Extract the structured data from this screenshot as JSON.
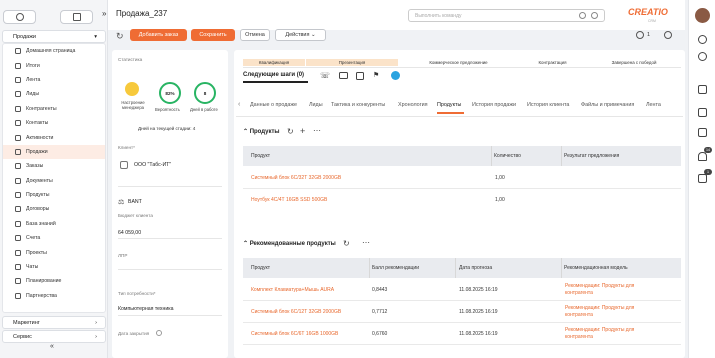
{
  "sidebar": {
    "section_label": "Продажи",
    "items": [
      {
        "label": "Домашняя страница",
        "icon": "home-icon"
      },
      {
        "label": "Итоги",
        "icon": "dashboard-icon"
      },
      {
        "label": "Лента",
        "icon": "feed-icon"
      },
      {
        "label": "Лиды",
        "icon": "lead-icon"
      },
      {
        "label": "Контрагенты",
        "icon": "company-icon"
      },
      {
        "label": "Контакты",
        "icon": "contact-icon"
      },
      {
        "label": "Активности",
        "icon": "calendar-icon"
      },
      {
        "label": "Продажи",
        "icon": "deal-icon",
        "active": true
      },
      {
        "label": "Заказы",
        "icon": "cart-icon"
      },
      {
        "label": "Документы",
        "icon": "document-icon"
      },
      {
        "label": "Продукты",
        "icon": "product-icon"
      },
      {
        "label": "Договоры",
        "icon": "contract-icon"
      },
      {
        "label": "База знаний",
        "icon": "knowledge-icon"
      },
      {
        "label": "Счета",
        "icon": "invoice-icon"
      },
      {
        "label": "Проекты",
        "icon": "project-icon"
      },
      {
        "label": "Чаты",
        "icon": "chat-icon"
      },
      {
        "label": "Планирование",
        "icon": "planning-icon"
      },
      {
        "label": "Партнерства",
        "icon": "partnership-icon"
      }
    ],
    "marketing_label": "Маркетинг",
    "service_label": "Сервис"
  },
  "header": {
    "title": "Продажа_237",
    "command_placeholder": "Выполнить команду",
    "brand": "CREATIO",
    "brand_sub": "CRM"
  },
  "toolbar": {
    "add_order_label": "Добавить заказ",
    "save_label": "Сохранить",
    "cancel_label": "Отмена",
    "actions_label": "Действия",
    "counter": "1"
  },
  "left_panel": {
    "stats_label": "Статистика",
    "mood_label": "Настроение менеджера",
    "probability_value": "82%",
    "probability_label": "Вероятность",
    "days_in_work_value": "8",
    "days_in_work_label": "Дней в работе",
    "days_in_stage_label": "Дней на текущей стадии:",
    "days_in_stage_value": "4",
    "client_label": "Клиент*",
    "client_value": "ООО \"Табс-ИТ\"",
    "bant_label": "BANT",
    "budget_label": "Бюджет клиента",
    "budget_value": "64 059,00",
    "lpr_label": "ЛПР",
    "need_type_label": "Тип потребности*",
    "need_type_value": "Компьютерная техника",
    "close_date_label": "Дата закрытия"
  },
  "stages": [
    "Квалификация",
    "Презентация",
    "Коммерческое предложение",
    "Контрактация",
    "Завершена с победой"
  ],
  "next_steps_label": "Следующие шаги (0)",
  "tabs": [
    "Данные о продаже",
    "Лиды",
    "Тактика и конкуренты",
    "Хронология",
    "Продукты",
    "История продажи",
    "История клиента",
    "Файлы и примечания",
    "Лента"
  ],
  "active_tab": "Продукты",
  "products": {
    "title": "Продукты",
    "columns": [
      "Продукт",
      "Количество",
      "Результат предложения"
    ],
    "rows": [
      {
        "product": "Системный блок 6С/32Т 32GB 2000GB",
        "qty": "1,00",
        "result": ""
      },
      {
        "product": "Ноутбук 4С/4Т 16GB SSD 500GB",
        "qty": "1,00",
        "result": ""
      }
    ]
  },
  "recommended": {
    "title": "Рекомендованные продукты",
    "columns": [
      "Продукт",
      "Балл рекомендации",
      "Дата прогноза",
      "Рекомендационная модель"
    ],
    "rows": [
      {
        "product": "Комплект Клавиатура+Мышь AURA",
        "score": "0,8443",
        "date": "11.08.2025 16:19",
        "model": "Рекомендации: Продукты для контрагента"
      },
      {
        "product": "Системный блок 6С/12Т 32GB 2000GB",
        "score": "0,7712",
        "date": "11.08.2025 16:19",
        "model": "Рекомендации: Продукты для контрагента"
      },
      {
        "product": "Системный блок 6С/6Т 16GB 1000GB",
        "score": "0,6760",
        "date": "11.08.2025 16:19",
        "model": "Рекомендации: Продукты для контрагента"
      }
    ]
  },
  "rail_badges": [
    "14",
    "1"
  ],
  "colors": {
    "accent": "#ef6c34",
    "positive": "#28b463",
    "stage_active": "#fbe3c9"
  }
}
